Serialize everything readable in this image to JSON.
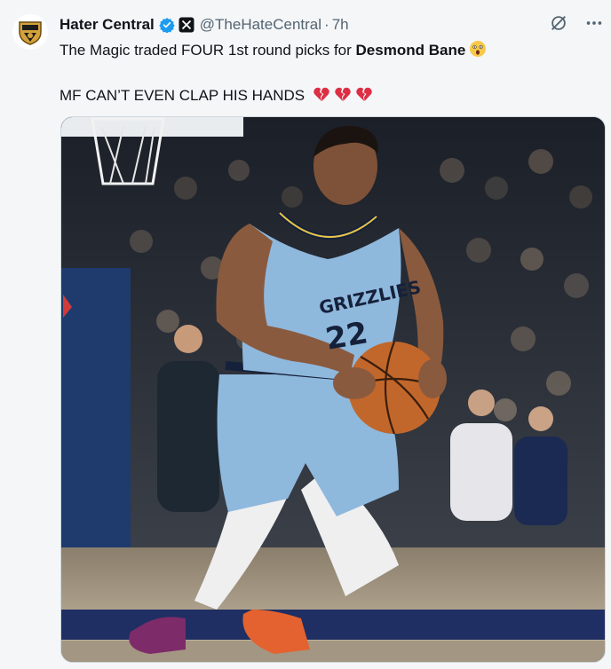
{
  "tweet": {
    "display_name": "Hater Central",
    "handle": "@TheHateCentral",
    "separator": "·",
    "time": "7h",
    "text_prefix": "The Magic traded FOUR 1st round picks for ",
    "text_bold": "Desmond Bane",
    "text_line2": "MF CAN’T EVEN CLAP HIS HANDS",
    "icons": {
      "avatar": "shield-crest-avatar",
      "verified": "verified-badge-icon",
      "affiliate": "x-badge-icon",
      "grok": "grok-icon",
      "more": "more-dots-icon",
      "emoji1": "astonished-face-emoji",
      "emoji2": "broken-heart-emoji"
    },
    "media": {
      "jersey_team": "GRIZZLIES",
      "jersey_number": "22"
    }
  },
  "colors": {
    "verified": "#1d9bf0",
    "muted": "#536471",
    "jersey": "#8fb8dd"
  }
}
